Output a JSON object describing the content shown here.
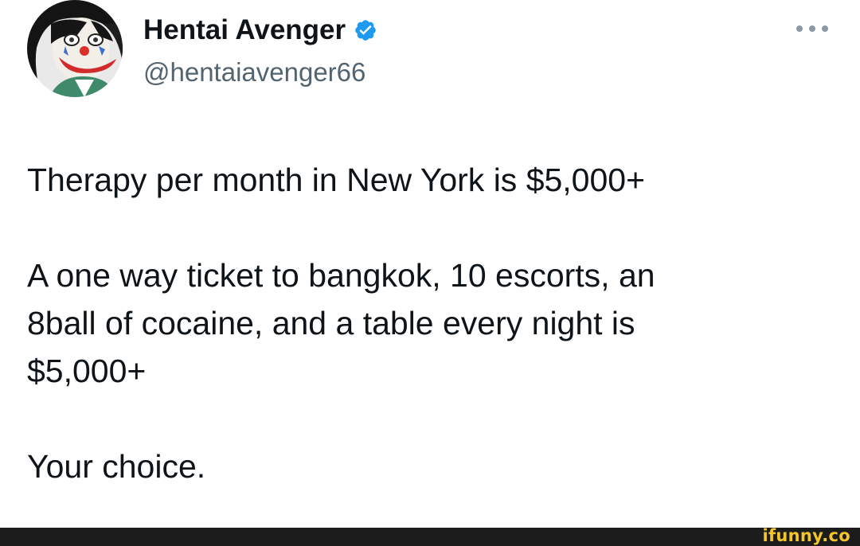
{
  "author": {
    "display_name": "Hentai Avenger",
    "handle": "@hentaiavenger66",
    "verified": true,
    "avatar_icon": "clown-anime-avatar-icon"
  },
  "tweet": {
    "lines": [
      "Therapy per month in New York is $5,000+",
      "",
      "A one way ticket to bangkok, 10 escorts, an",
      "8ball of cocaine, and a table every night is",
      "$5,000+",
      "",
      "Your choice."
    ]
  },
  "more_icon": "more-options-icon",
  "watermark": {
    "text": "ifunny.co",
    "color": "#f4c52b"
  },
  "colors": {
    "verified_badge": "#1d9bf0",
    "text_primary": "#0f1419",
    "text_secondary": "#536471"
  }
}
